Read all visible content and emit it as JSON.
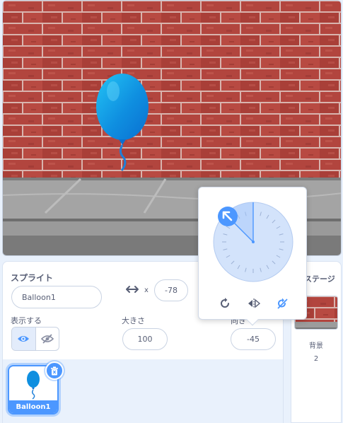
{
  "stage": {
    "background": "brick-wall",
    "sprite_icon": "balloon-sprite"
  },
  "sprite_info": {
    "heading": "スプライト",
    "name_value": "Balloon1",
    "x_label": "x",
    "x_value": "-78",
    "show_label": "表示する",
    "size_label": "大きさ",
    "size_value": "100",
    "direction_label": "向き",
    "direction_value": "-45",
    "show_icon": "eye-icon",
    "hide_icon": "eye-slash-icon"
  },
  "sprite_list": {
    "items": [
      {
        "label": "Balloon1",
        "selected": true
      }
    ],
    "delete_icon": "trash-icon"
  },
  "stage_panel": {
    "title": "ステージ",
    "backdrop_label": "背景",
    "backdrop_count": "2"
  },
  "direction_popover": {
    "direction_degrees": -45,
    "modes": [
      {
        "name": "all-around",
        "icon": "rotate-all-around-icon",
        "selected": false
      },
      {
        "name": "left-right",
        "icon": "flip-left-right-icon",
        "selected": false
      },
      {
        "name": "dont-rotate",
        "icon": "dont-rotate-icon",
        "selected": true
      }
    ]
  },
  "colors": {
    "accent": "#4c97ff",
    "text": "#575e75",
    "panel_bg": "#e9f1fc",
    "brick": "#b0463f",
    "mortar": "#d7b7b3",
    "pavement": "#8f8f8f"
  }
}
